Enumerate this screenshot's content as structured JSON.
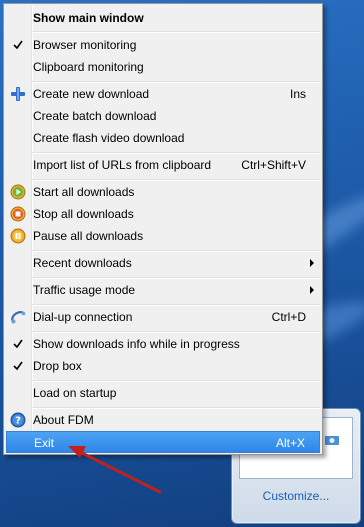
{
  "menu": {
    "items": [
      {
        "label": "Show main window",
        "bold": true,
        "icon": "",
        "shortcut": "",
        "submenu": false,
        "checked": false
      },
      {
        "label": "Browser monitoring",
        "icon": "check-icon",
        "checked": true
      },
      {
        "label": "Clipboard monitoring",
        "icon": "",
        "checked": false
      },
      {
        "label": "Create new download",
        "icon": "plus-icon",
        "shortcut": "Ins"
      },
      {
        "label": "Create batch download"
      },
      {
        "label": "Create flash video download"
      },
      {
        "label": "Import list of URLs from clipboard",
        "shortcut": "Ctrl+Shift+V"
      },
      {
        "label": "Start all downloads",
        "icon": "play-icon"
      },
      {
        "label": "Stop all downloads",
        "icon": "stop-icon"
      },
      {
        "label": "Pause all downloads",
        "icon": "pause-icon"
      },
      {
        "label": "Recent downloads",
        "submenu": true
      },
      {
        "label": "Traffic usage mode",
        "submenu": true
      },
      {
        "label": "Dial-up connection",
        "icon": "dialup-icon",
        "shortcut": "Ctrl+D"
      },
      {
        "label": "Show downloads info while in progress",
        "icon": "check-icon",
        "checked": true
      },
      {
        "label": "Drop box",
        "icon": "check-icon",
        "checked": true
      },
      {
        "label": "Load on startup"
      },
      {
        "label": "About FDM",
        "icon": "help-icon"
      },
      {
        "label": "Exit",
        "shortcut": "Alt+X",
        "highlighted": true
      }
    ]
  },
  "tray": {
    "customize_label": "Customize..."
  },
  "colors": {
    "highlight": "#2f86e8",
    "arrow": "#c0211c",
    "desktop": "#1f5fae"
  }
}
